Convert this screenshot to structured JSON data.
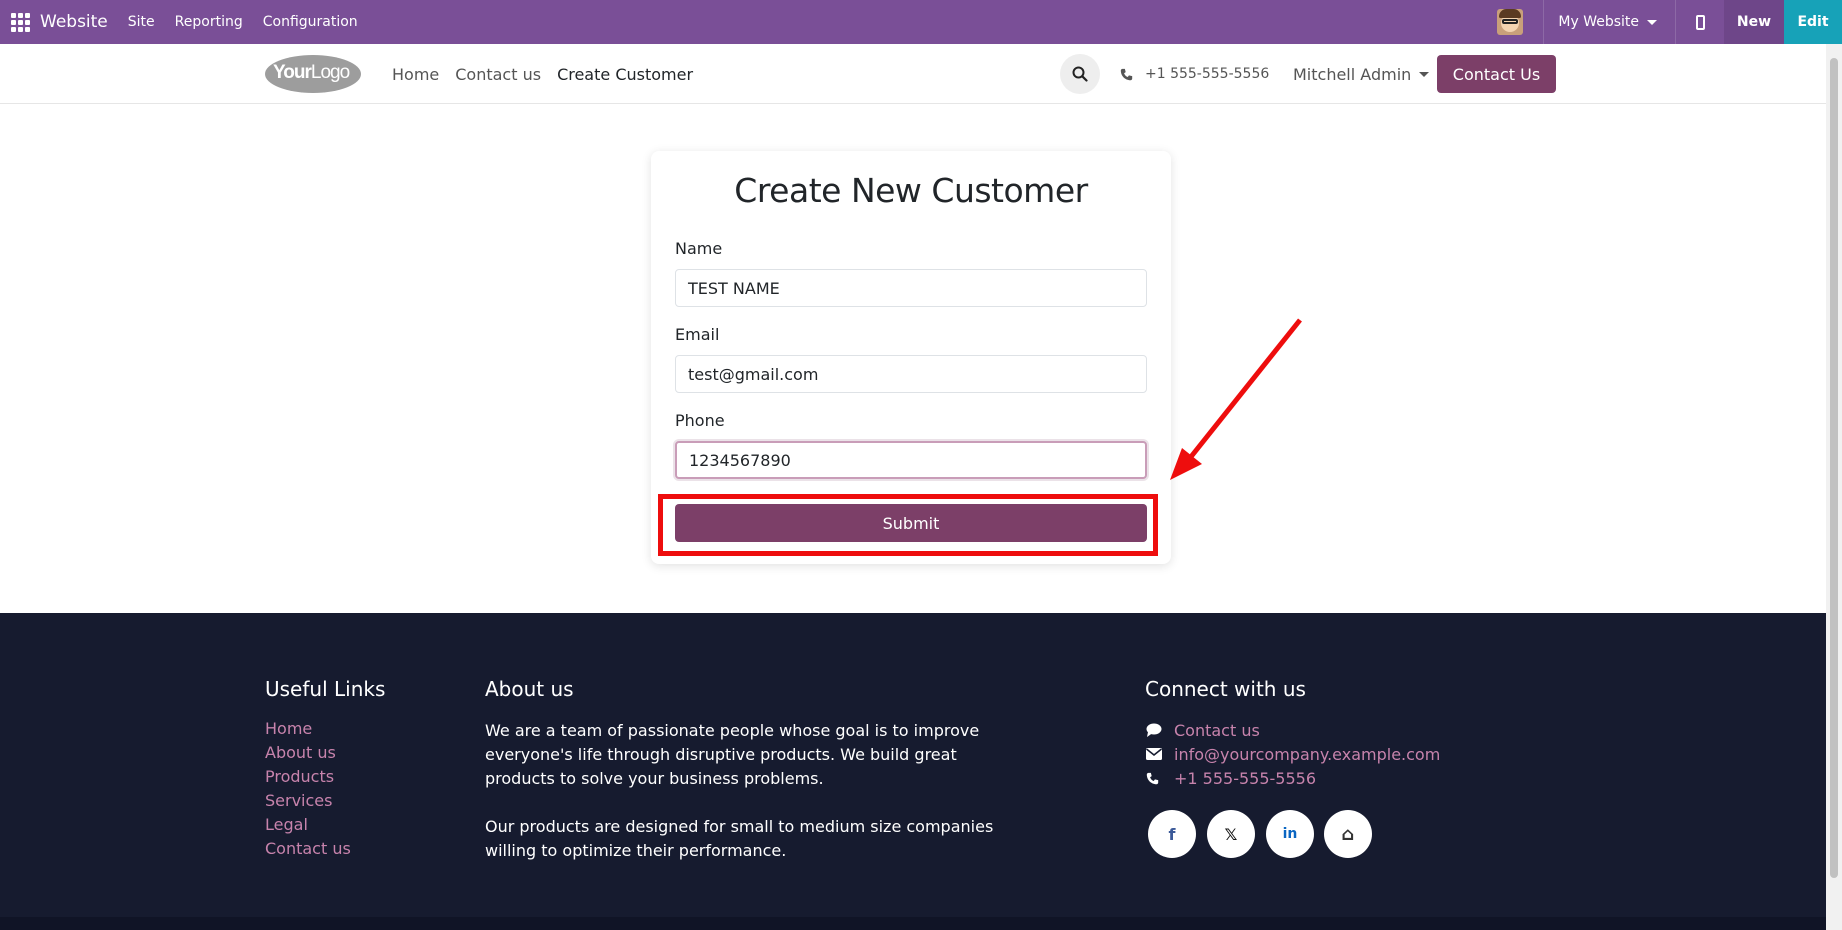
{
  "topbar": {
    "app_name": "Website",
    "menus": [
      "Site",
      "Reporting",
      "Configuration"
    ],
    "website_selector": "My Website",
    "new_label": "New",
    "edit_label": "Edit"
  },
  "header": {
    "logo_text_bold": "Your",
    "logo_text_light": "Logo",
    "nav": [
      "Home",
      "Contact us",
      "Create Customer"
    ],
    "phone": "+1 555-555-5556",
    "user": "Mitchell Admin",
    "cta_label": "Contact Us"
  },
  "form": {
    "title": "Create New Customer",
    "fields": [
      {
        "label": "Name",
        "value": "TEST NAME"
      },
      {
        "label": "Email",
        "value": "test@gmail.com"
      },
      {
        "label": "Phone",
        "value": "1234567890"
      }
    ],
    "submit_label": "Submit"
  },
  "footer": {
    "useful_links_title": "Useful Links",
    "useful_links": [
      "Home",
      "About us",
      "Products",
      "Services",
      "Legal",
      "Contact us"
    ],
    "about_title": "About us",
    "about_p1": "We are a team of passionate people whose goal is to improve everyone's life through disruptive products. We build great products to solve your business problems.",
    "about_p2": "Our products are designed for small to medium size companies willing to optimize their performance.",
    "connect_title": "Connect with us",
    "connect_contact": "Contact us",
    "connect_email": "info@yourcompany.example.com",
    "connect_phone": "+1 555-555-5556",
    "social": [
      "f",
      "𝕏",
      "in",
      "⌂"
    ]
  },
  "colors": {
    "topbar": "#7a4f97",
    "primary": "#7c3f68",
    "edit": "#17a2b8",
    "footer_bg": "#161b2f",
    "footer_link": "#c783ac",
    "annotation": "#ee0d0d"
  }
}
